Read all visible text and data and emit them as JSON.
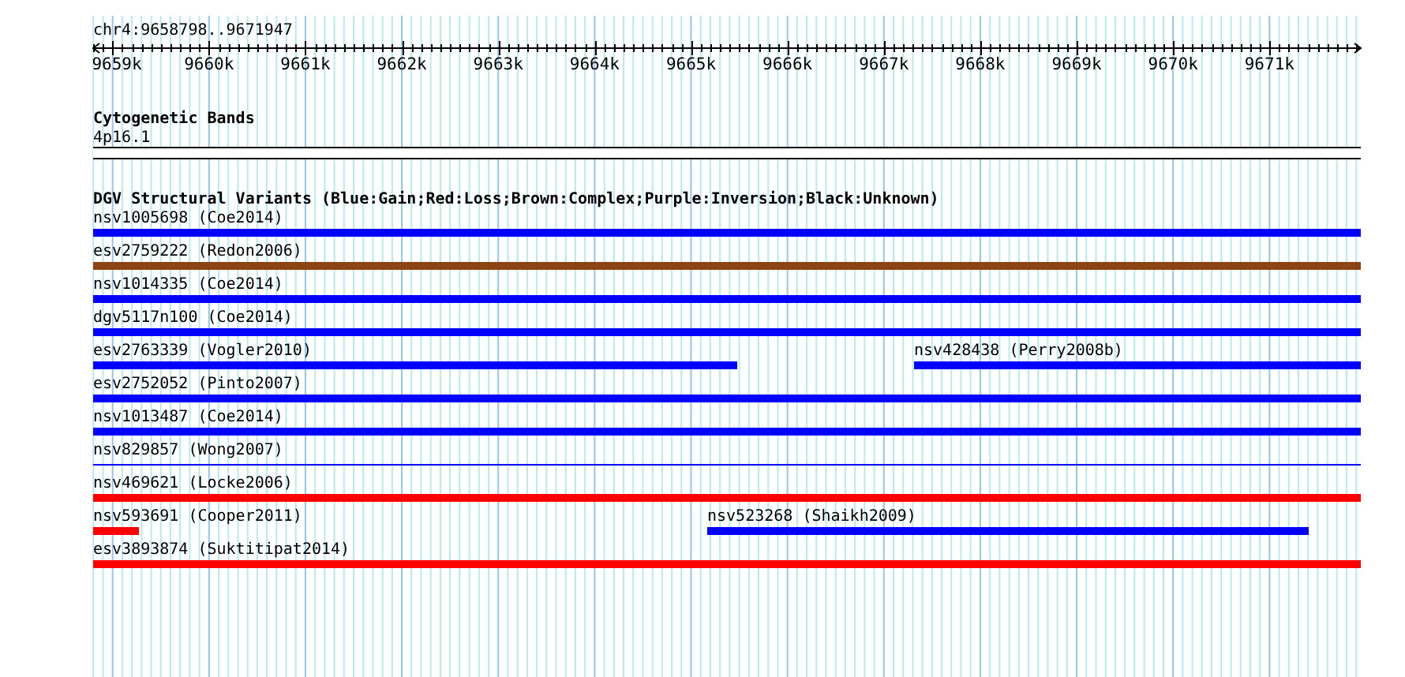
{
  "ruler": {
    "location": "chr4:9658798..9671947",
    "ticks": [
      "9659k",
      "9660k",
      "9661k",
      "9662k",
      "9663k",
      "9664k",
      "9665k",
      "9666k",
      "9667k",
      "9668k",
      "9669k",
      "9670k",
      "9671k"
    ]
  },
  "cytoband_track": {
    "title": "Cytogenetic Bands",
    "band": "4p16.1"
  },
  "variant_track": {
    "title": "DGV Structural Variants (Blue:Gain;Red:Loss;Brown:Complex;Purple:Inversion;Black:Unknown)",
    "rows": [
      {
        "features": [
          {
            "label": "nsv1005698 (Coe2014)",
            "color": "#0000ff",
            "kind": "bar"
          }
        ]
      },
      {
        "features": [
          {
            "label": "esv2759222 (Redon2006)",
            "color": "#8b4513",
            "kind": "bar"
          }
        ]
      },
      {
        "features": [
          {
            "label": "nsv1014335 (Coe2014)",
            "color": "#0000ff",
            "kind": "bar"
          }
        ]
      },
      {
        "features": [
          {
            "label": "dgv5117n100 (Coe2014)",
            "color": "#0000ff",
            "kind": "bar"
          }
        ]
      },
      {
        "features": [
          {
            "label": "esv2763339 (Vogler2010)",
            "color": "#0000ff",
            "kind": "bar"
          },
          {
            "label": "nsv428438 (Perry2008b)",
            "color": "#0000ff",
            "kind": "bar"
          }
        ]
      },
      {
        "features": [
          {
            "label": "esv2752052 (Pinto2007)",
            "color": "#0000ff",
            "kind": "bar"
          }
        ]
      },
      {
        "features": [
          {
            "label": "nsv1013487 (Coe2014)",
            "color": "#0000ff",
            "kind": "bar"
          }
        ]
      },
      {
        "features": [
          {
            "label": "nsv829857 (Wong2007)",
            "color": "#0000ff",
            "kind": "line"
          }
        ]
      },
      {
        "features": [
          {
            "label": "nsv469621 (Locke2006)",
            "color": "#ff0000",
            "kind": "bar"
          }
        ]
      },
      {
        "features": [
          {
            "label": "nsv593691 (Cooper2011)",
            "color": "#ff0000",
            "kind": "bar"
          },
          {
            "label": "nsv523268 (Shaikh2009)",
            "color": "#0000ff",
            "kind": "bar"
          }
        ]
      },
      {
        "features": [
          {
            "label": "esv3893874 (Suktitipat2014)",
            "color": "#ff0000",
            "kind": "bar"
          }
        ]
      }
    ]
  }
}
